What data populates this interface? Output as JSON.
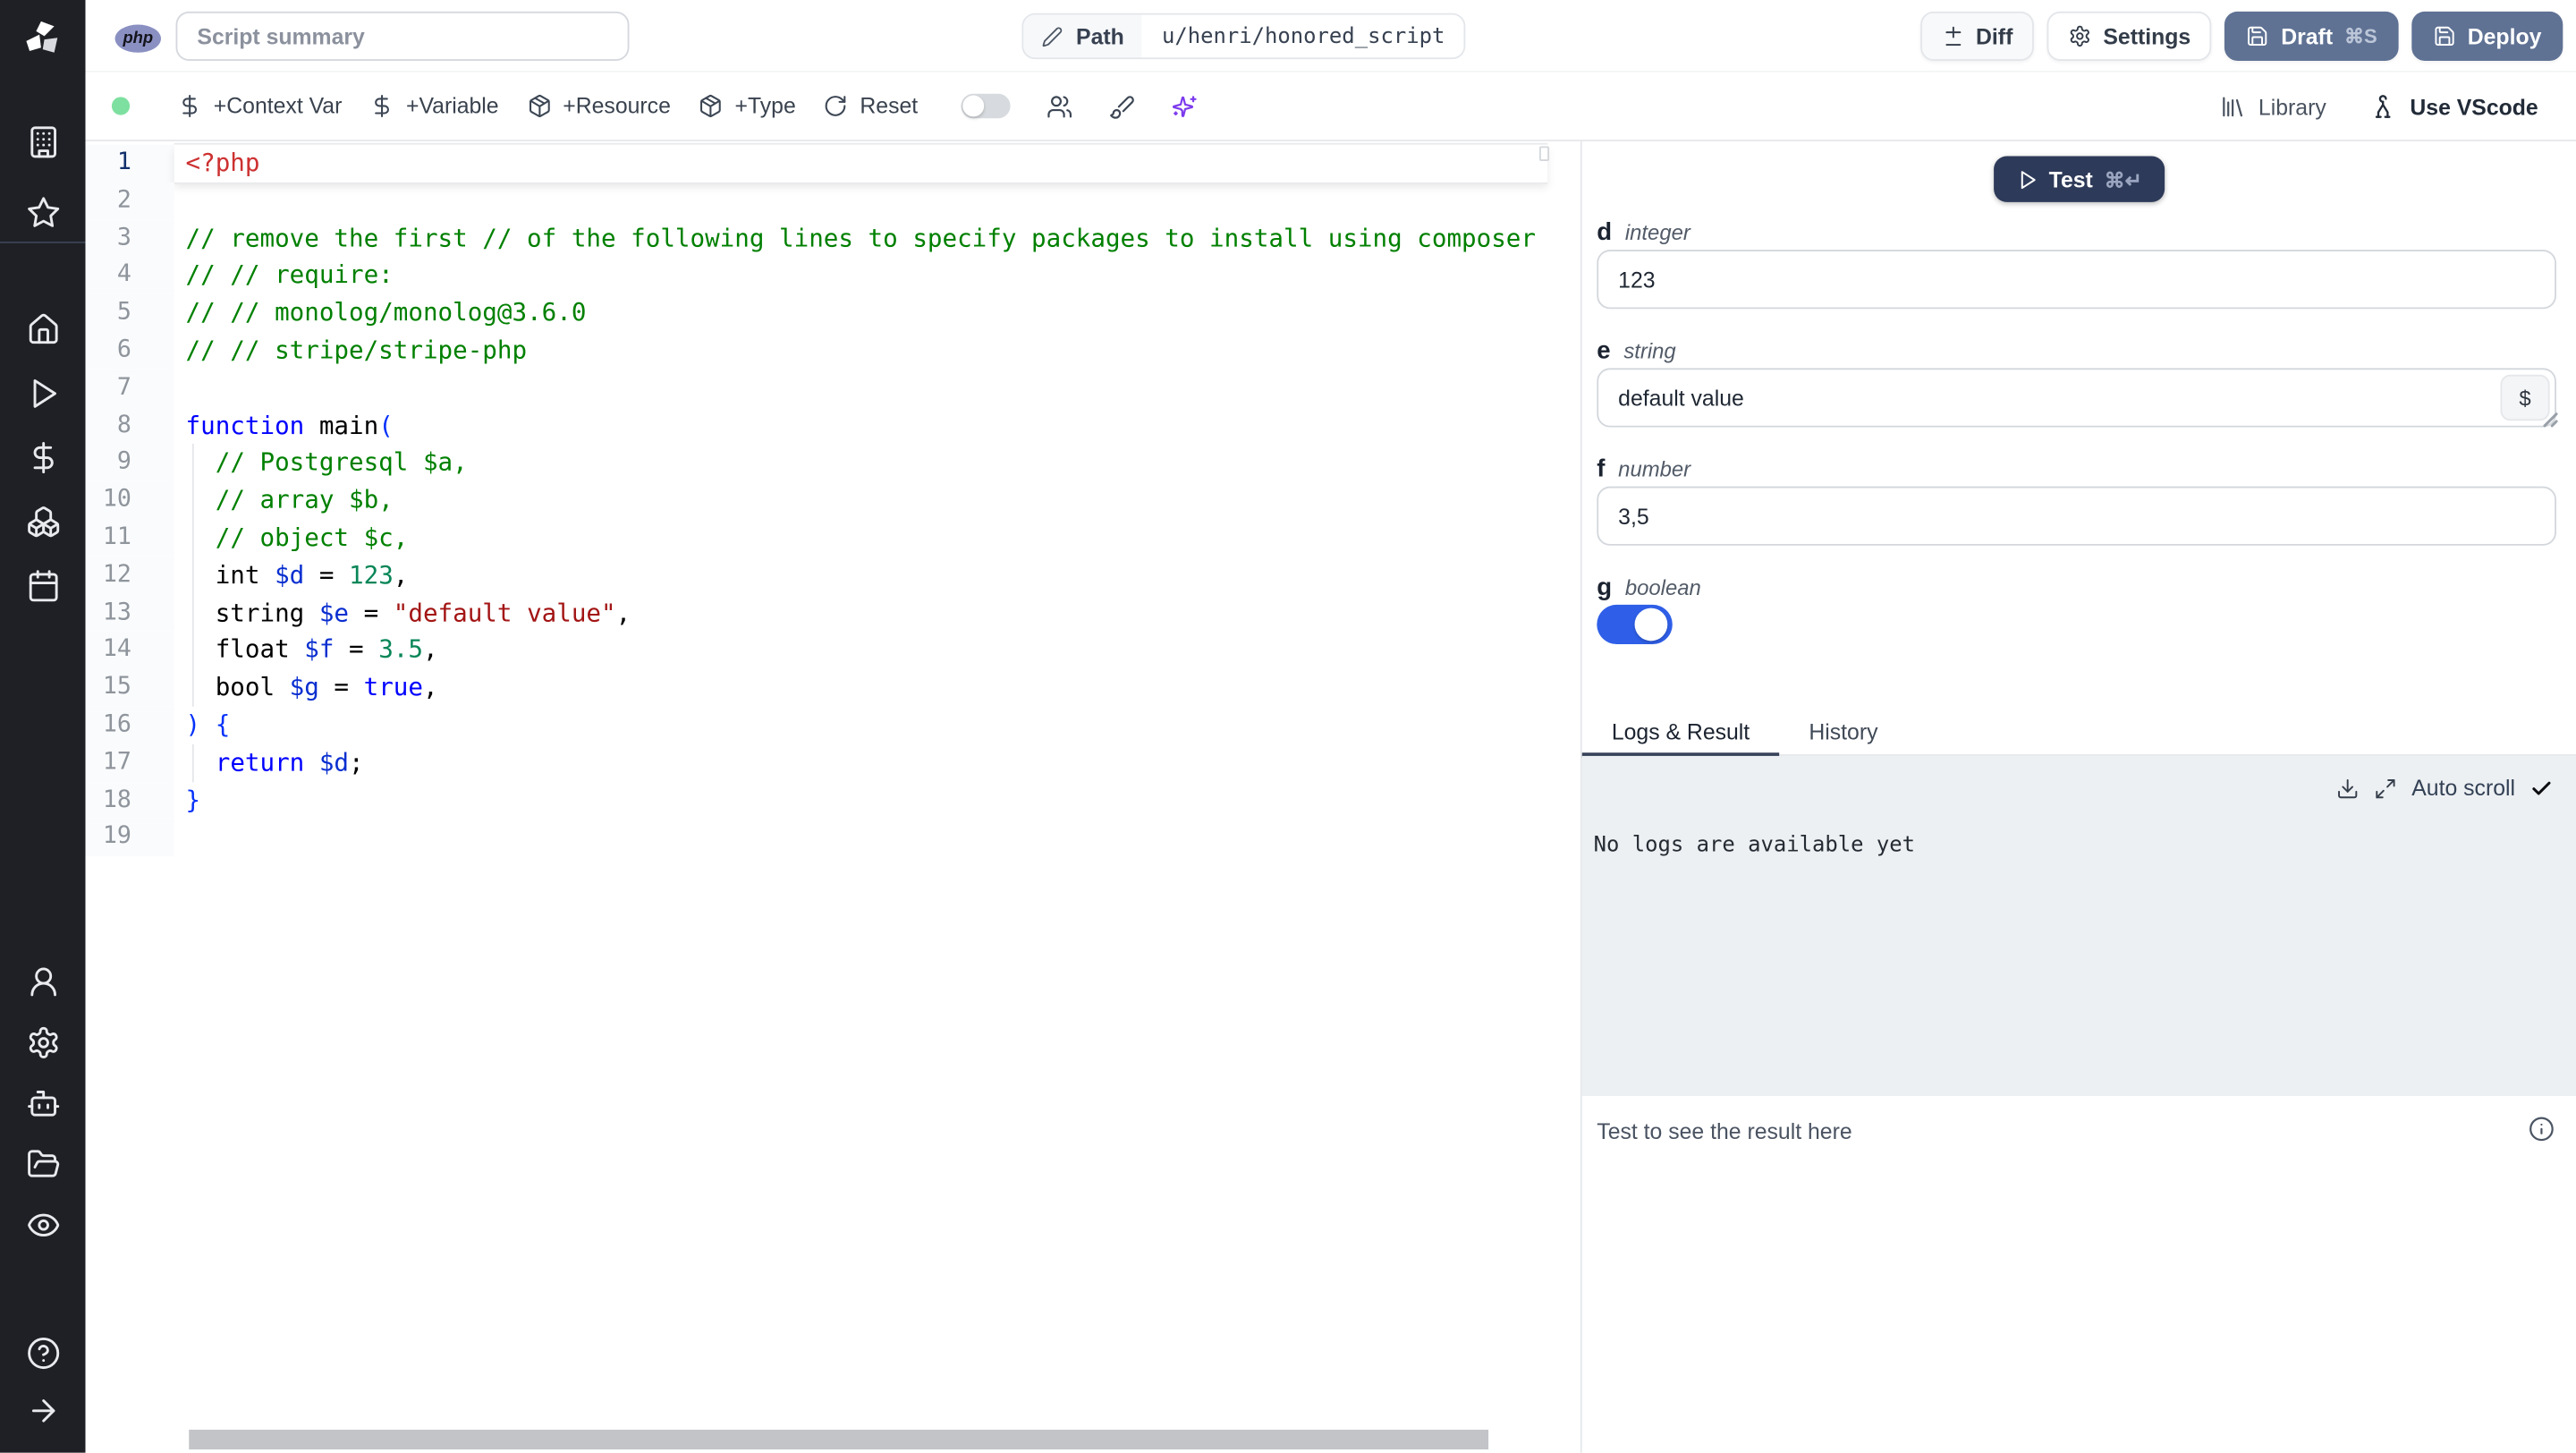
{
  "topbar": {
    "language_badge": "php",
    "summary_placeholder": "Script summary",
    "path_label": "Path",
    "path_value": "u/henri/honored_script",
    "diff_label": "Diff",
    "settings_label": "Settings",
    "draft_label": "Draft",
    "draft_shortcut": "⌘S",
    "deploy_label": "Deploy"
  },
  "toolbar": {
    "items": [
      {
        "icon": "dollar",
        "label": "+Context Var"
      },
      {
        "icon": "dollar",
        "label": "+Variable"
      },
      {
        "icon": "package",
        "label": "+Resource"
      },
      {
        "icon": "package",
        "label": "+Type"
      },
      {
        "icon": "rotate",
        "label": "Reset"
      }
    ],
    "library_label": "Library",
    "vscode_label": "Use VScode"
  },
  "sidebar": {
    "groups": [
      {
        "items": [
          {
            "icon": "building",
            "name": "workspace"
          },
          {
            "icon": "star",
            "name": "favorites"
          }
        ]
      },
      {
        "items": [
          {
            "icon": "home",
            "name": "home"
          },
          {
            "icon": "play",
            "name": "runs"
          },
          {
            "icon": "dollar",
            "name": "variables"
          },
          {
            "icon": "boxes",
            "name": "resources"
          },
          {
            "icon": "calendar",
            "name": "schedules"
          }
        ]
      },
      {
        "items": [
          {
            "icon": "user",
            "name": "users"
          },
          {
            "icon": "gear",
            "name": "settings"
          },
          {
            "icon": "bot",
            "name": "workers"
          },
          {
            "icon": "folder",
            "name": "folders"
          },
          {
            "icon": "eye",
            "name": "audit-logs"
          }
        ]
      },
      {
        "items": [
          {
            "icon": "help",
            "name": "help"
          },
          {
            "icon": "arrow",
            "name": "collapse-sidebar"
          }
        ]
      }
    ]
  },
  "editor": {
    "language": "php",
    "lines": [
      {
        "num": 1,
        "active": true,
        "tokens": [
          {
            "c": "tag",
            "t": "<?php"
          }
        ]
      },
      {
        "num": 2,
        "tokens": []
      },
      {
        "num": 3,
        "tokens": [
          {
            "c": "cmt",
            "t": "// remove the first // of the following lines to specify packages to install using composer"
          }
        ]
      },
      {
        "num": 4,
        "tokens": [
          {
            "c": "cmt",
            "t": "// // require:"
          }
        ]
      },
      {
        "num": 5,
        "tokens": [
          {
            "c": "cmt",
            "t": "// // monolog/monolog@3.6.0"
          }
        ]
      },
      {
        "num": 6,
        "tokens": [
          {
            "c": "cmt",
            "t": "// // stripe/stripe-php"
          }
        ]
      },
      {
        "num": 7,
        "tokens": []
      },
      {
        "num": 8,
        "tokens": [
          {
            "c": "kw",
            "t": "function"
          },
          {
            "c": "pl",
            "t": " main"
          },
          {
            "c": "brk",
            "t": "("
          }
        ]
      },
      {
        "num": 9,
        "tokens": [
          {
            "c": "pl",
            "t": "  "
          },
          {
            "c": "cmt",
            "t": "// Postgresql $a,"
          }
        ]
      },
      {
        "num": 10,
        "tokens": [
          {
            "c": "pl",
            "t": "  "
          },
          {
            "c": "cmt",
            "t": "// array $b,"
          }
        ]
      },
      {
        "num": 11,
        "tokens": [
          {
            "c": "pl",
            "t": "  "
          },
          {
            "c": "cmt",
            "t": "// object $c,"
          }
        ]
      },
      {
        "num": 12,
        "tokens": [
          {
            "c": "pl",
            "t": "  int "
          },
          {
            "c": "var",
            "t": "$d"
          },
          {
            "c": "pl",
            "t": " = "
          },
          {
            "c": "num",
            "t": "123"
          },
          {
            "c": "pl",
            "t": ","
          }
        ]
      },
      {
        "num": 13,
        "tokens": [
          {
            "c": "pl",
            "t": "  string "
          },
          {
            "c": "var",
            "t": "$e"
          },
          {
            "c": "pl",
            "t": " = "
          },
          {
            "c": "str",
            "t": "\"default value\""
          },
          {
            "c": "pl",
            "t": ","
          }
        ]
      },
      {
        "num": 14,
        "tokens": [
          {
            "c": "pl",
            "t": "  float "
          },
          {
            "c": "var",
            "t": "$f"
          },
          {
            "c": "pl",
            "t": " = "
          },
          {
            "c": "num",
            "t": "3.5"
          },
          {
            "c": "pl",
            "t": ","
          }
        ]
      },
      {
        "num": 15,
        "tokens": [
          {
            "c": "pl",
            "t": "  bool "
          },
          {
            "c": "var",
            "t": "$g"
          },
          {
            "c": "pl",
            "t": " = "
          },
          {
            "c": "kw",
            "t": "true"
          },
          {
            "c": "pl",
            "t": ","
          }
        ]
      },
      {
        "num": 16,
        "tokens": [
          {
            "c": "brk",
            "t": ") {"
          }
        ]
      },
      {
        "num": 17,
        "tokens": [
          {
            "c": "pl",
            "t": "  "
          },
          {
            "c": "kw",
            "t": "return"
          },
          {
            "c": "pl",
            "t": " "
          },
          {
            "c": "var",
            "t": "$d"
          },
          {
            "c": "pl",
            "t": ";"
          }
        ]
      },
      {
        "num": 18,
        "tokens": [
          {
            "c": "brk",
            "t": "}"
          }
        ]
      },
      {
        "num": 19,
        "tokens": []
      }
    ]
  },
  "runner": {
    "test_label": "Test",
    "test_shortcut": "⌘↵",
    "fields": [
      {
        "name": "d",
        "type": "integer",
        "value": "123"
      },
      {
        "name": "e",
        "type": "string",
        "value": "default value",
        "var_picker": "$"
      },
      {
        "name": "f",
        "type": "number",
        "value": "3,5"
      },
      {
        "name": "g",
        "type": "boolean",
        "value": true
      }
    ],
    "tabs": [
      {
        "label": "Logs & Result",
        "active": true
      },
      {
        "label": "History",
        "active": false
      }
    ],
    "autoscroll_label": "Auto scroll",
    "logs_empty": "No logs are available yet",
    "result_placeholder": "Test to see the result here"
  },
  "colors": {
    "accent_slate": "#5f7294",
    "test_button": "#2e3a59",
    "toggle_on": "#2f5fe8",
    "ai_purple": "#7c3aed",
    "php_badge": "#8a90c2",
    "status_green": "#7ee0a0",
    "tab_underline": "#38435a",
    "logs_background": "#edf0f3",
    "sidebar_background": "#1e2025"
  }
}
